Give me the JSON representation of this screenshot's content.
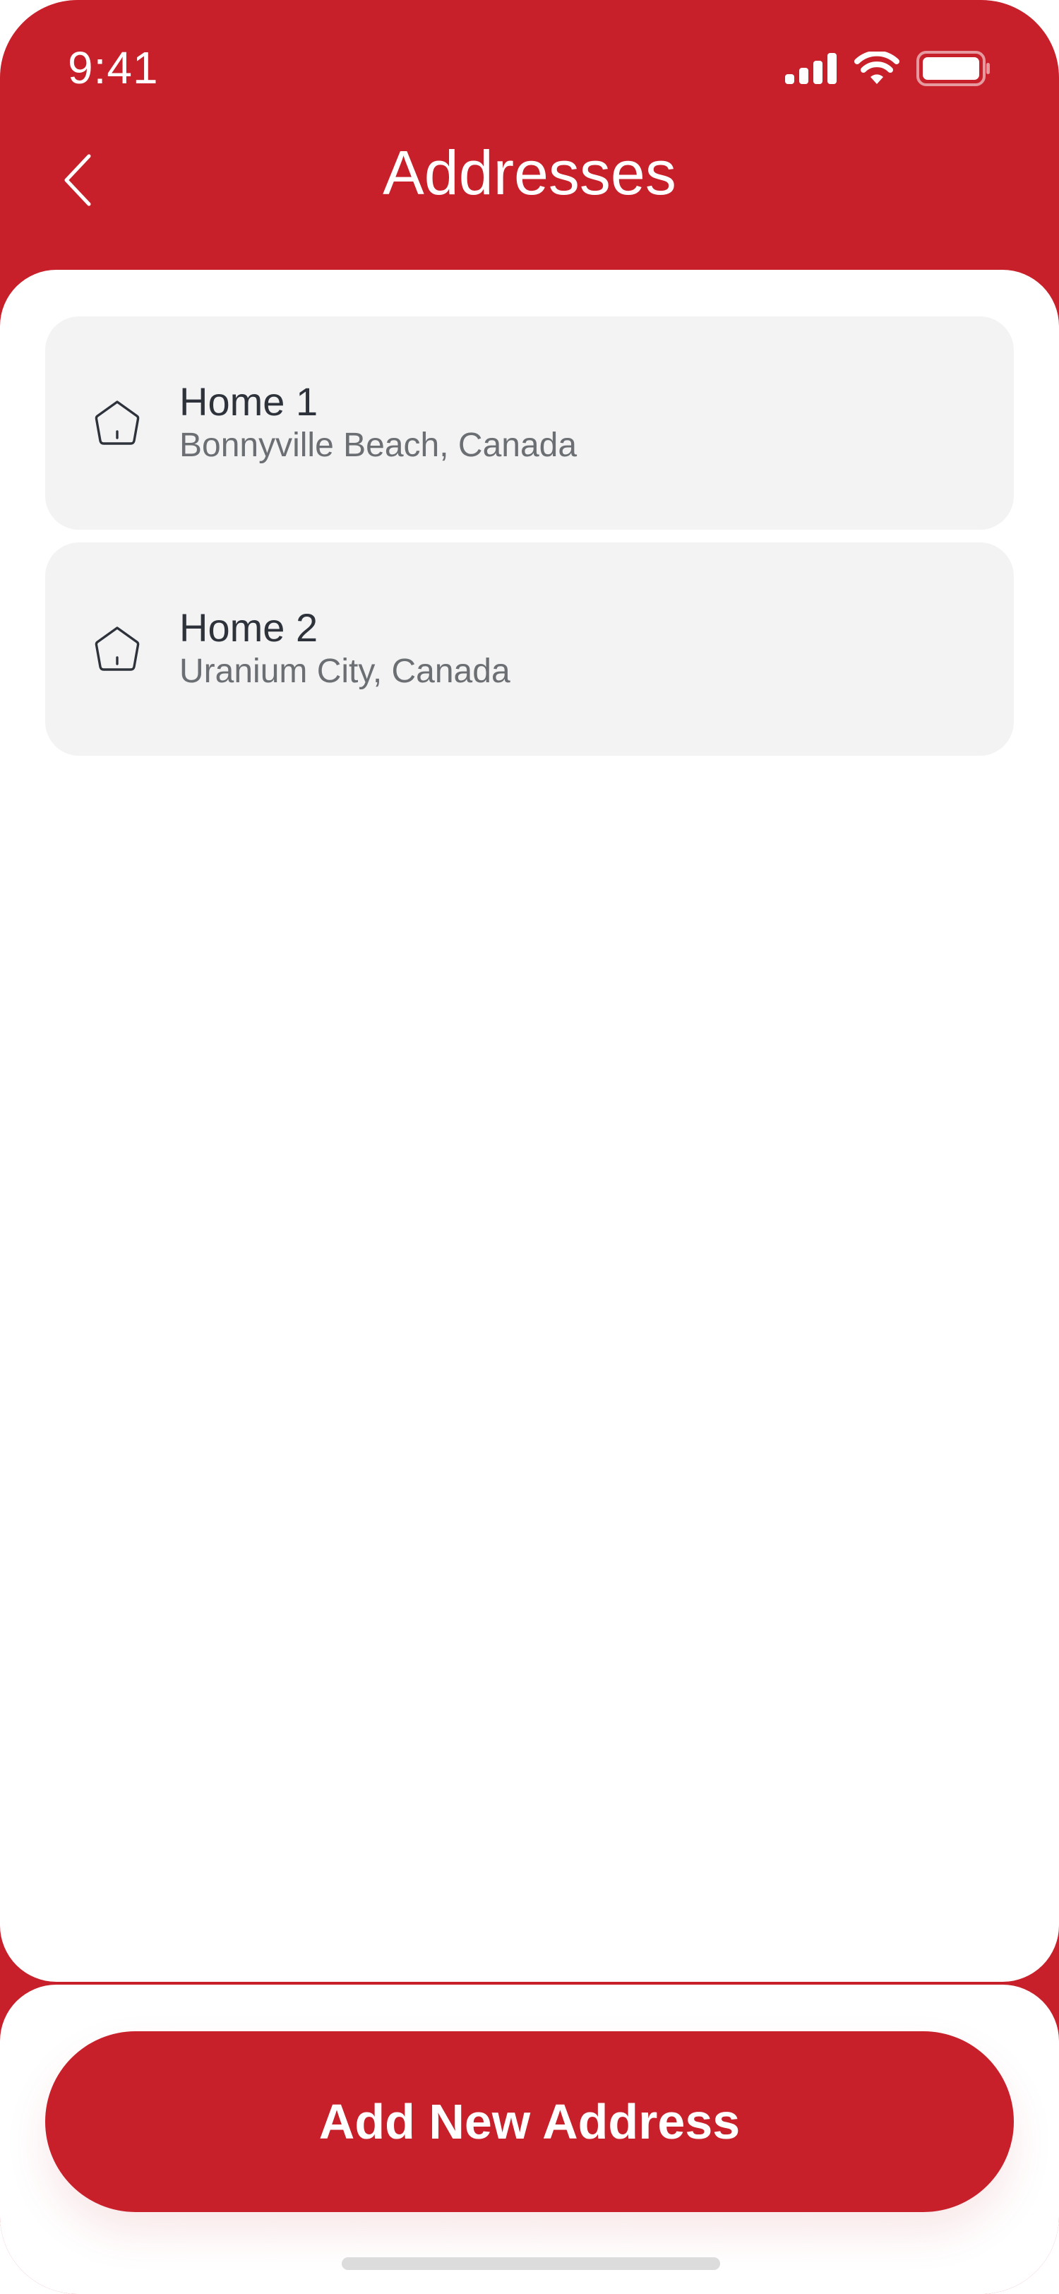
{
  "status_bar": {
    "time": "9:41",
    "icons": [
      "cellular-signal-icon",
      "wifi-icon",
      "battery-icon"
    ]
  },
  "header": {
    "back_icon": "chevron-left-icon",
    "title": "Addresses"
  },
  "addresses": [
    {
      "icon": "home-icon",
      "name": "Home 1",
      "location": "Bonnyville Beach, Canada"
    },
    {
      "icon": "home-icon",
      "name": "Home 2",
      "location": "Uranium City, Canada"
    }
  ],
  "actions": {
    "add_label": "Add New Address"
  },
  "colors": {
    "brand": "#C8202A",
    "card": "#F3F3F3",
    "text_primary": "#2E333B",
    "text_secondary": "#6B6E72"
  }
}
